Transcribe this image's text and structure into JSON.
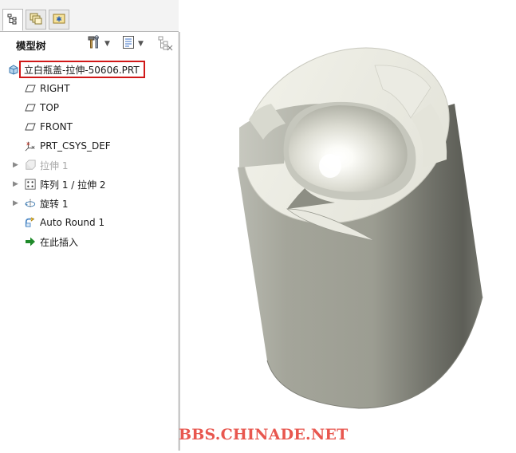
{
  "tabs": [
    {
      "name": "model-tree",
      "icon": "tree-structure-icon",
      "active": true
    },
    {
      "name": "folder-browser",
      "icon": "folder-stack-icon",
      "active": false
    },
    {
      "name": "favorites",
      "icon": "star-folder-icon",
      "active": false
    }
  ],
  "toolbar": {
    "title": "模型树",
    "settings_icon": "hammer-wrench-icon",
    "show_icon": "list-settings-icon",
    "filter_icon": "filter-tree-icon"
  },
  "tree": {
    "root": {
      "label": "立白瓶盖-拉伸-50606.PRT",
      "icon": "part-icon",
      "highlight_color": "#d01818"
    },
    "items": [
      {
        "label": "RIGHT",
        "icon": "datum-plane-icon",
        "expandable": false,
        "suppressed": false
      },
      {
        "label": "TOP",
        "icon": "datum-plane-icon",
        "expandable": false,
        "suppressed": false
      },
      {
        "label": "FRONT",
        "icon": "datum-plane-icon",
        "expandable": false,
        "suppressed": false
      },
      {
        "label": "PRT_CSYS_DEF",
        "icon": "coordinate-system-icon",
        "expandable": false,
        "suppressed": false
      },
      {
        "label": "拉伸 1",
        "icon": "extrude-icon",
        "expandable": true,
        "suppressed": true
      },
      {
        "label": "阵列 1 / 拉伸 2",
        "icon": "pattern-icon",
        "expandable": true,
        "suppressed": false
      },
      {
        "label": "旋转 1",
        "icon": "revolve-icon",
        "expandable": true,
        "suppressed": false
      },
      {
        "label": "Auto Round 1",
        "icon": "auto-round-icon",
        "expandable": false,
        "suppressed": false
      },
      {
        "label": "在此插入",
        "icon": "insert-here-arrow-icon",
        "expandable": false,
        "suppressed": false
      }
    ]
  },
  "viewport": {
    "model": "bottle-cap-3d-model",
    "body_color": "#a9aa9f",
    "top_color": "#eeeee6"
  },
  "watermark": "BBS.CHINADE.NET"
}
